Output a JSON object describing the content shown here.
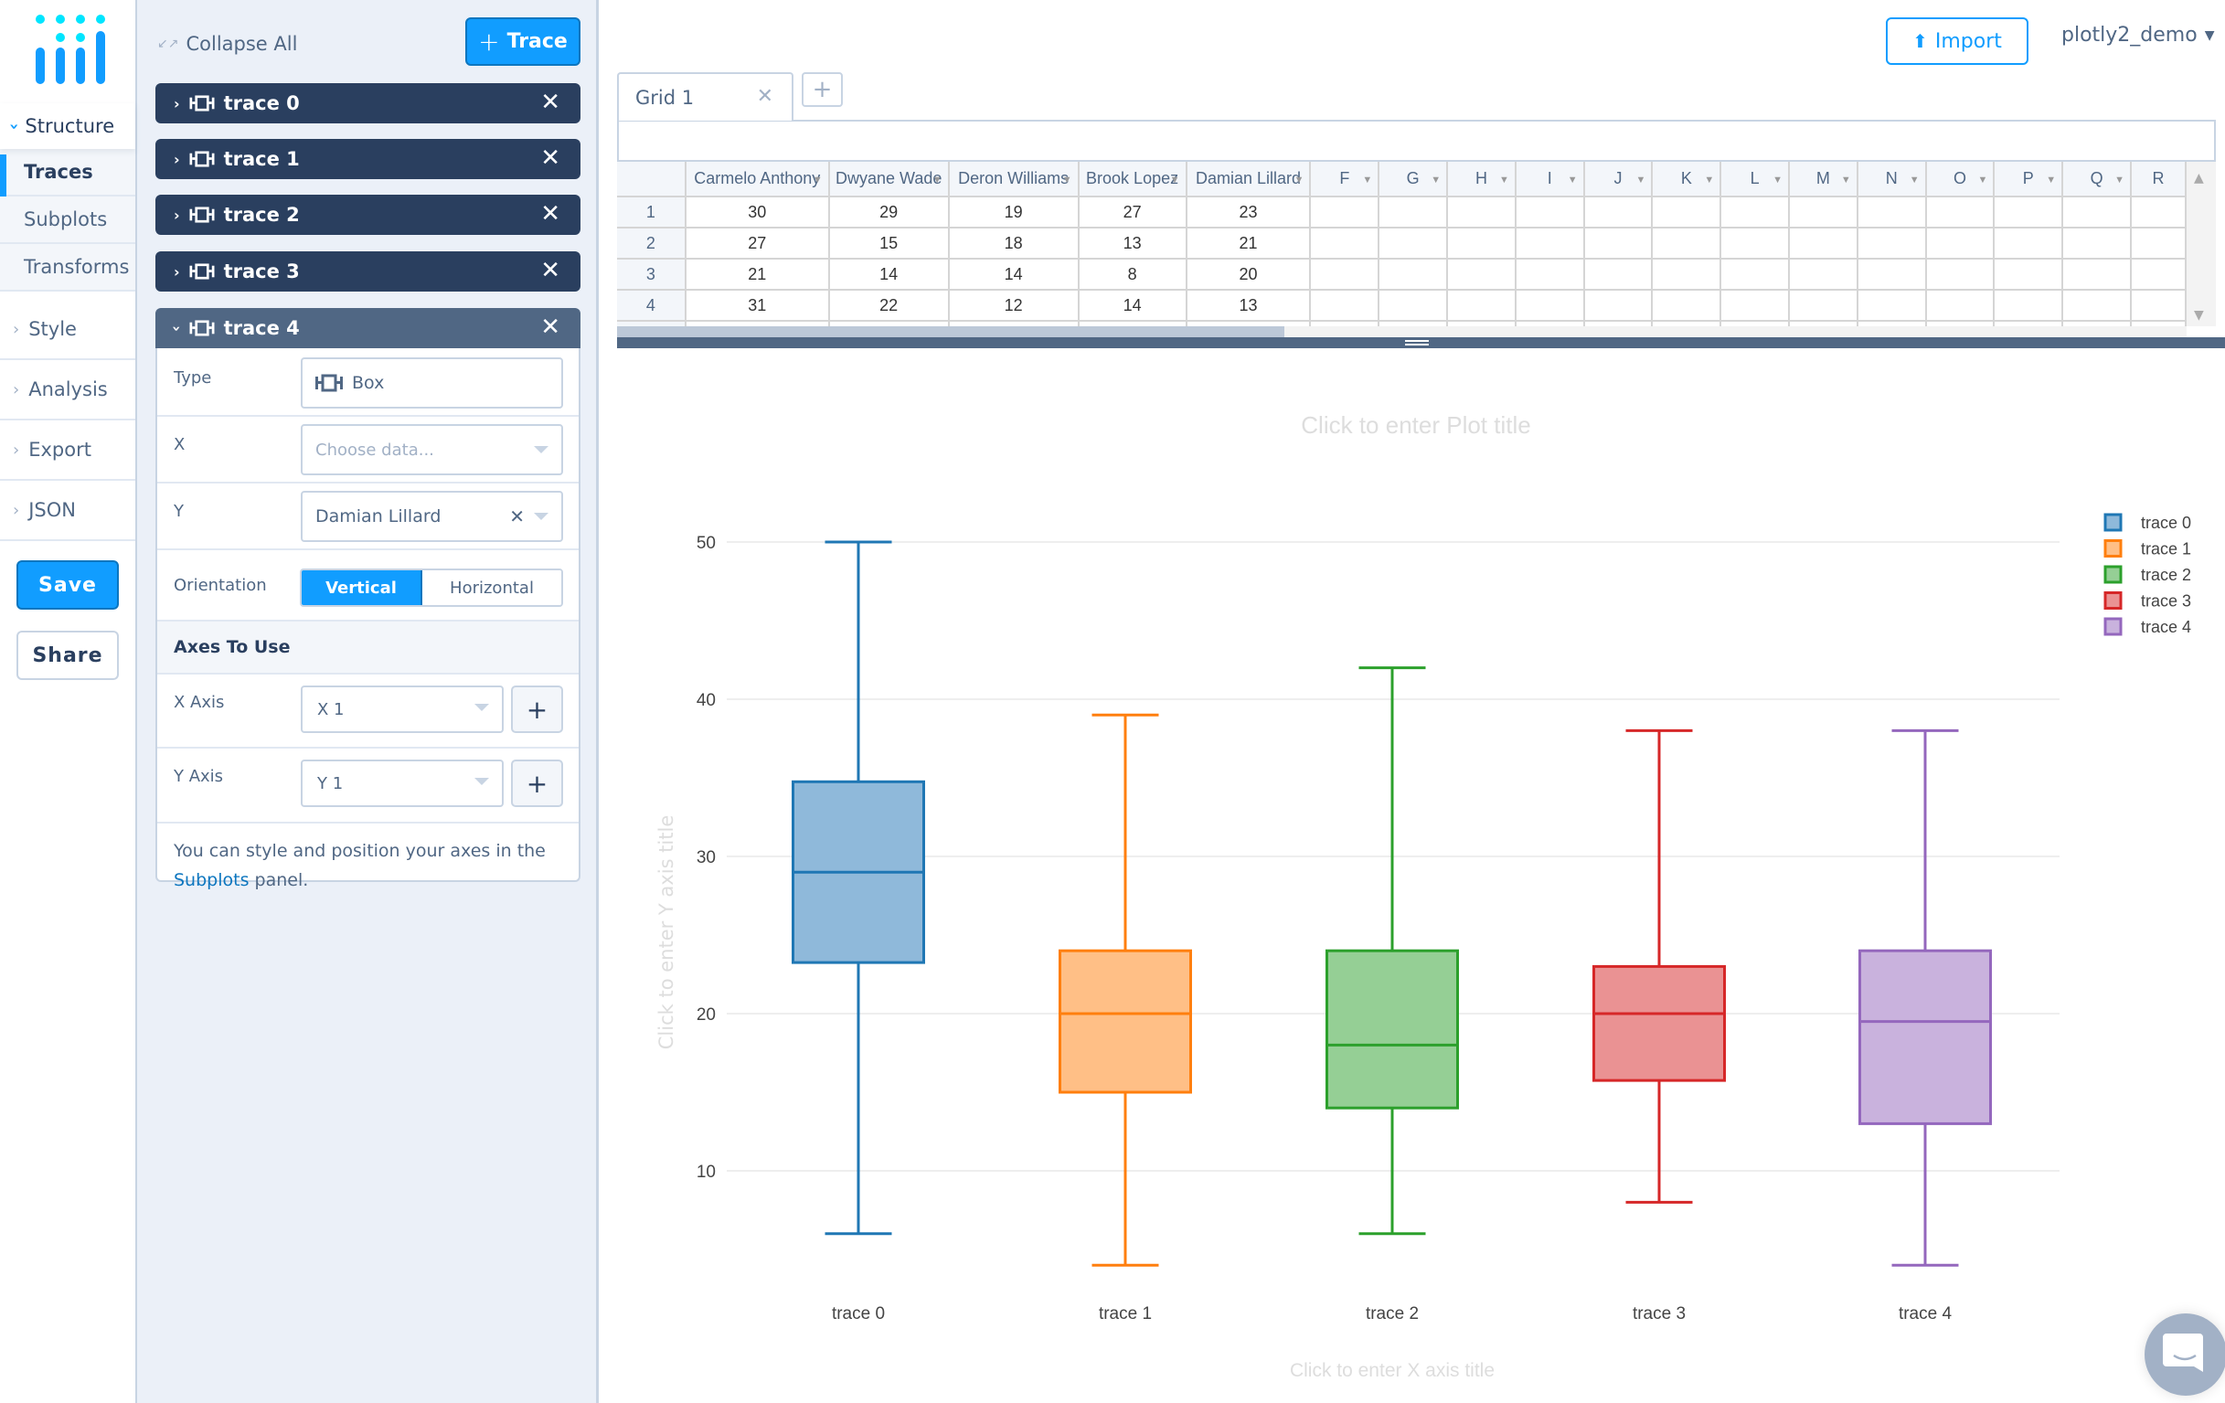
{
  "nav": {
    "structure_label": "Structure",
    "sub_items": [
      {
        "label": "Traces",
        "active": true
      },
      {
        "label": "Subplots",
        "active": false
      },
      {
        "label": "Transforms",
        "active": false
      }
    ],
    "items": [
      {
        "label": "Style"
      },
      {
        "label": "Analysis"
      },
      {
        "label": "Export"
      },
      {
        "label": "JSON"
      }
    ],
    "save_label": "Save",
    "share_label": "Share"
  },
  "panel": {
    "collapse_all_label": "Collapse All",
    "add_trace_label": "Trace",
    "traces": [
      {
        "name": "trace 0",
        "open": false
      },
      {
        "name": "trace 1",
        "open": false
      },
      {
        "name": "trace 2",
        "open": false
      },
      {
        "name": "trace 3",
        "open": false
      },
      {
        "name": "trace 4",
        "open": true
      }
    ],
    "open_trace": {
      "type_label": "Type",
      "type_value": "Box",
      "x_label": "X",
      "x_placeholder": "Choose data...",
      "y_label": "Y",
      "y_value": "Damian Lillard",
      "orientation_label": "Orientation",
      "orientation_options": [
        "Vertical",
        "Horizontal"
      ],
      "orientation_selected": "Vertical",
      "axes_section": "Axes To Use",
      "x_axis_label": "X Axis",
      "x_axis_value": "X 1",
      "y_axis_label": "Y Axis",
      "y_axis_value": "Y 1",
      "help_text_before": "You can style and position your axes in the ",
      "help_link": "Subplots",
      "help_text_after": " panel."
    }
  },
  "topbar": {
    "import_label": "Import",
    "user_label": "plotly2_demo"
  },
  "grid": {
    "tabs": [
      {
        "label": "Grid 1"
      }
    ],
    "add_tab_label": "+",
    "columns": [
      "Carmelo Anthony",
      "Dwyane Wade",
      "Deron Williams",
      "Brook Lopez",
      "Damian Lillard",
      "F",
      "G",
      "H",
      "I",
      "J",
      "K",
      "L",
      "M",
      "N",
      "O",
      "P",
      "Q",
      "R"
    ],
    "rows": [
      {
        "index": "1",
        "cells": [
          "30",
          "29",
          "19",
          "27",
          "23"
        ]
      },
      {
        "index": "2",
        "cells": [
          "27",
          "15",
          "18",
          "13",
          "21"
        ]
      },
      {
        "index": "3",
        "cells": [
          "21",
          "14",
          "14",
          "8",
          "20"
        ]
      },
      {
        "index": "4",
        "cells": [
          "31",
          "22",
          "12",
          "14",
          "13"
        ]
      }
    ]
  },
  "colors": {
    "accent": "#119dff",
    "nav_dark": "#2a3f5f",
    "nav_open": "#506784",
    "panel_bg": "#ebf0f8"
  },
  "chart_data": {
    "type": "box",
    "title": "Click to enter Plot title",
    "xlabel": "Click to enter X axis title",
    "ylabel": "Click to enter Y axis title",
    "ylim": [
      0,
      55
    ],
    "yticks": [
      10,
      20,
      30,
      40,
      50
    ],
    "grid": true,
    "legend_position": "top-right",
    "categories": [
      "trace 0",
      "trace 1",
      "trace 2",
      "trace 3",
      "trace 4"
    ],
    "series": [
      {
        "name": "trace 0",
        "color": "#1f77b4",
        "fill": "#8fb9da",
        "min": 6,
        "q1": 23.25,
        "median": 29,
        "q3": 34.75,
        "max": 50
      },
      {
        "name": "trace 1",
        "color": "#ff7f0e",
        "fill": "#ffbf86",
        "min": 4,
        "q1": 15,
        "median": 20,
        "q3": 24,
        "max": 39
      },
      {
        "name": "trace 2",
        "color": "#2ca02c",
        "fill": "#95cf95",
        "min": 6,
        "q1": 14,
        "median": 18,
        "q3": 24,
        "max": 42
      },
      {
        "name": "trace 3",
        "color": "#d62728",
        "fill": "#ea9293",
        "min": 8,
        "q1": 15.75,
        "median": 20,
        "q3": 23,
        "max": 38
      },
      {
        "name": "trace 4",
        "color": "#9467bd",
        "fill": "#c9b2dd",
        "min": 4,
        "q1": 13,
        "median": 19.5,
        "q3": 24,
        "max": 38
      }
    ]
  }
}
